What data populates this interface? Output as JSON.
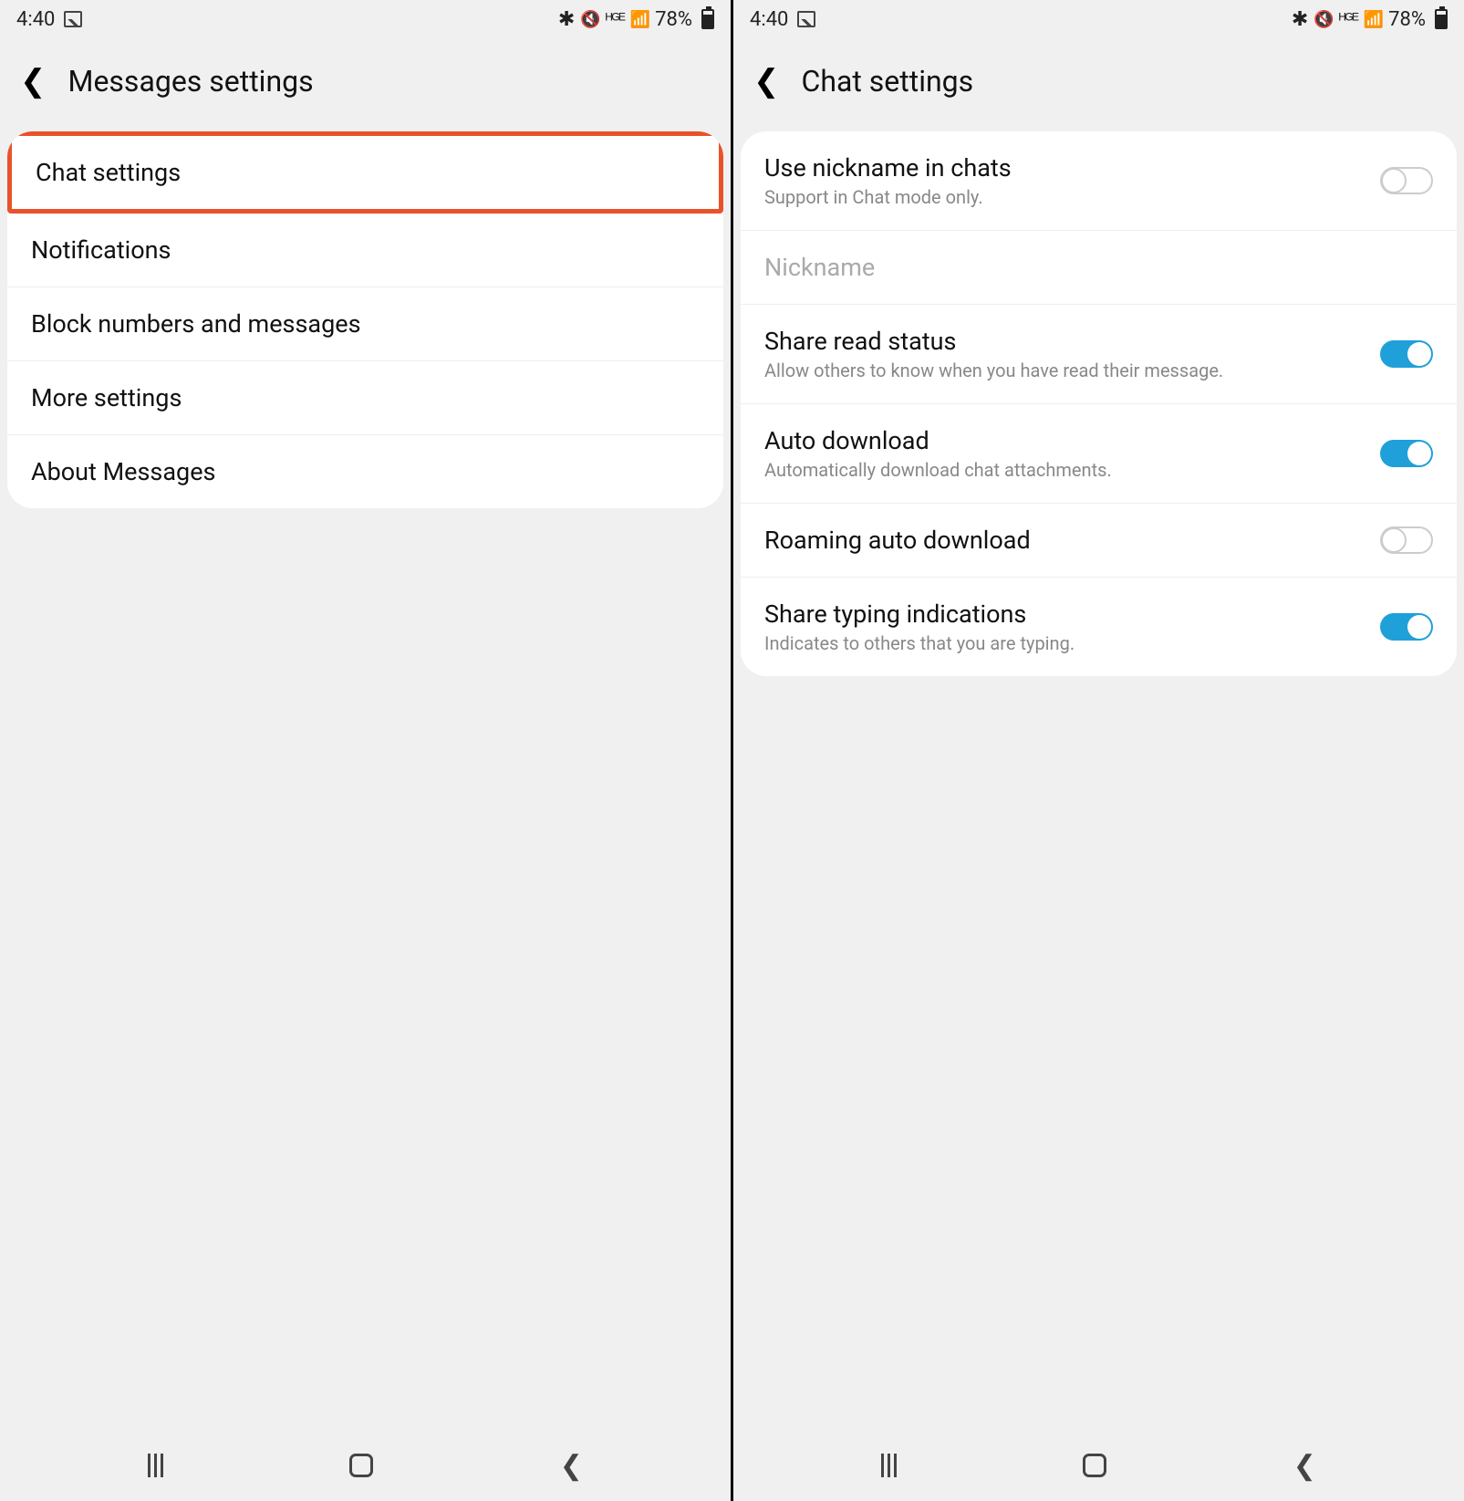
{
  "status": {
    "time": "4:40",
    "battery_pct": "78%"
  },
  "left": {
    "title": "Messages settings",
    "rows": [
      {
        "label": "Chat settings"
      },
      {
        "label": "Notifications"
      },
      {
        "label": "Block numbers and messages"
      },
      {
        "label": "More settings"
      },
      {
        "label": "About Messages"
      }
    ]
  },
  "right": {
    "title": "Chat settings",
    "rows": [
      {
        "label": "Use nickname in chats",
        "sub": "Support in Chat mode only.",
        "toggle": "off"
      },
      {
        "label": "Nickname",
        "disabled": true
      },
      {
        "label": "Share read status",
        "sub": "Allow others to know when you have read their message.",
        "toggle": "on"
      },
      {
        "label": "Auto download",
        "sub": "Automatically download chat attachments.",
        "toggle": "on"
      },
      {
        "label": "Roaming auto download",
        "toggle": "off"
      },
      {
        "label": "Share typing indications",
        "sub": "Indicates to others that you are typing.",
        "toggle": "on"
      }
    ]
  }
}
